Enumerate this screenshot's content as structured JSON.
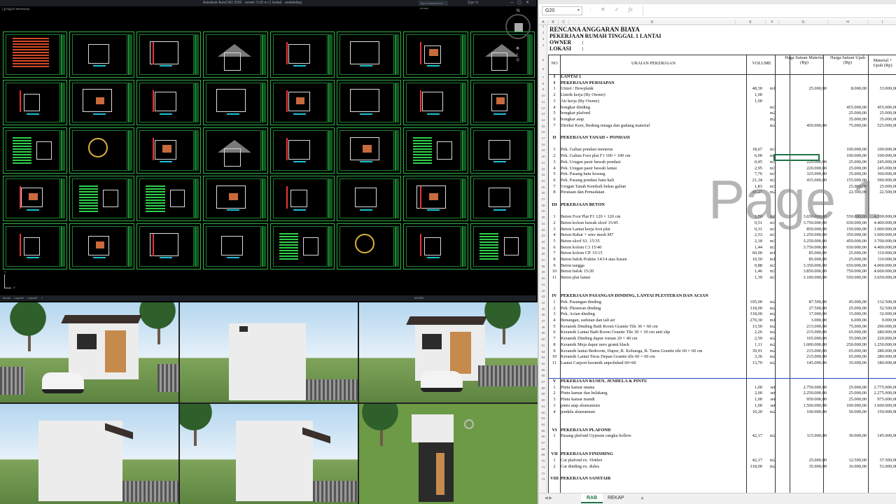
{
  "cad": {
    "title": "Autodesk AutoCAD 2020 · rumah 7x10 m (1 lantai) · arsitekdwg",
    "search_placeholder": "Type a keyword or phrase",
    "sign_in": "Sign In",
    "viewport_label": "[-][Top][2D Wireframe]",
    "compass_n": "N",
    "compass_top": "TOP",
    "tabs": [
      "Model",
      "Layout1",
      "Layout2",
      "+"
    ],
    "model_label": "MODEL"
  },
  "excel": {
    "namebox": "G20",
    "formula_symbol": "fx",
    "columns": [
      "A",
      "B",
      "C",
      "D",
      "E",
      "F",
      "G",
      "H",
      "I"
    ],
    "title": "RENCANA ANGGARAN BIAYA",
    "pekerjaan_label": "PEKERJAAN",
    "pekerjaan_value": ":  RUMAH TINGGAL 1 LANTAI",
    "owner_label": "OWNER",
    "owner_value": ":",
    "lokasi_label": "LOKASI",
    "lokasi_value": ":",
    "header": {
      "no": "NO",
      "uraian": "URAIAN PEKERJAAN",
      "volume": "VOLUME",
      "material": "Haga Satuan Material (Rp)",
      "upah": "Harga Satuan Upah (Rp)",
      "total": "Material + Upah (Rp)"
    },
    "watermark": "Page 1",
    "rows": [
      {
        "r": 7,
        "no": "I",
        "ur": "LANTAI 1",
        "sec": true
      },
      {
        "r": 8,
        "no": "I",
        "ur": "PEKERJAAN PERSIAPAN",
        "sec": true
      },
      {
        "r": 9,
        "no": "1",
        "ur": "Uitzet / Bowplank",
        "vol": "48,30",
        "sat": "m1",
        "mat": "25.000,00",
        "up": "8.000,00",
        "tot": "33.000,00"
      },
      {
        "r": 10,
        "no": "2",
        "ur": "Listrik kerja (By Owner)",
        "vol": "1,00",
        "tot": "-"
      },
      {
        "r": 11,
        "no": "3",
        "ur": "Air kerja (By Owner)",
        "vol": "1,00",
        "tot": "-"
      },
      {
        "r": 12,
        "no": "4",
        "ur": "bongkar dinding",
        "sat": "m3",
        "up": "455.000,00",
        "tot": "455.000,00"
      },
      {
        "r": 13,
        "no": "5",
        "ur": "bongkar plafond",
        "sat": "m2",
        "up": "25.000,00",
        "tot": "25.000,00"
      },
      {
        "r": 14,
        "no": "6",
        "ur": "bongkar atap",
        "sat": "m2",
        "up": "35.000,00",
        "tot": "35.000,00"
      },
      {
        "r": 15,
        "no": "7",
        "ur": "Direksi Keet, Bedeng tenaga dan gudang material",
        "sat": "m2",
        "mat": "450.000,00",
        "up": "75.000,00",
        "tot": "525.000,00"
      },
      {
        "r": 16
      },
      {
        "r": 17,
        "no": "II",
        "ur": "PEKERJAAN TANAH + PONDASI",
        "sec": true
      },
      {
        "r": 18
      },
      {
        "r": 19,
        "no": "1",
        "ur": "Pek. Galian pondasi menerus",
        "vol": "18,67",
        "sat": "m3",
        "up": "100.000,00",
        "tot": "100.000,00"
      },
      {
        "r": 20,
        "no": "2",
        "ur": "Pek. Galian Foot plat F1 100 × 100 cm",
        "vol": "6,00",
        "sat": "m3",
        "up": "100.000,00",
        "tot": "100.000,00"
      },
      {
        "r": 21,
        "no": "3",
        "ur": "Pek. Urugan pasir bawah pondasi",
        "vol": "0,45",
        "sat": "m3",
        "mat": "220.000,00",
        "up": "25.000,00",
        "tot": "245.000,00"
      },
      {
        "r": 22,
        "no": "4",
        "ur": "Pek. Urugan pasir bawah lantai",
        "vol": "2,95",
        "sat": "m3",
        "mat": "220.000,00",
        "up": "25.000,00",
        "tot": "245.000,00"
      },
      {
        "r": 23,
        "no": "5",
        "ur": "Pek. Pasang batu kosong",
        "vol": "7,76",
        "sat": "m3",
        "mat": "325.000,00",
        "up": "35.000,00",
        "tot": "360.000,00"
      },
      {
        "r": 24,
        "no": "6",
        "ur": "Pek. Pasang pondasi batu kali",
        "vol": "21,34",
        "sat": "m3",
        "mat": "435.000,00",
        "up": "155.000,00",
        "tot": "590.000,00"
      },
      {
        "r": 25,
        "no": "7",
        "ur": "Urugan Tanah Kembali bekas galian",
        "vol": "1,83",
        "sat": "m3",
        "up": "25.000,00",
        "tot": "25.000,00"
      },
      {
        "r": 26,
        "no": "8",
        "ur": "Perataan dan Pemadatan",
        "vol": "45,27",
        "sat": "m2",
        "up": "22.500,00",
        "tot": "22.500,00"
      },
      {
        "r": 27
      },
      {
        "r": 28,
        "no": "III",
        "ur": "PEKERJAAN BETON",
        "sec": true
      },
      {
        "r": 29
      },
      {
        "r": 30,
        "no": "1",
        "ur": "Beton Foot Plat F1 120 × 120 cm",
        "vol": "1,50",
        "sat": "m3",
        "mat": "3.650.000,00",
        "up": "550.000,00",
        "tot": "4.200.000,00"
      },
      {
        "r": 31,
        "no": "2",
        "ur": "Beton kolom bawah sloof 15/45",
        "vol": "0,51",
        "sat": "m3",
        "mat": "3.750.000,00",
        "up": "650.000,00",
        "tot": "4.400.000,00"
      },
      {
        "r": 32,
        "no": "3",
        "ur": "Beton Lantai kerja foot plat",
        "vol": "0,31",
        "sat": "m3",
        "mat": "850.000,00",
        "up": "150.000,00",
        "tot": "1.000.000,00"
      },
      {
        "r": 33,
        "no": "4",
        "ur": "Beton Rabat + wire mesh M7",
        "vol": "2,53",
        "sat": "m3",
        "mat": "1.250.000,00",
        "up": "350.000,00",
        "tot": "1.600.000,00"
      },
      {
        "r": 34,
        "no": "5",
        "ur": "Beton sloof S1. 15/35",
        "vol": "2,18",
        "sat": "m3",
        "mat": "3.250.000,00",
        "up": "450.000,00",
        "tot": "3.700.000,00"
      },
      {
        "r": 35,
        "no": "6",
        "ur": "Beton kolom C3 15/40",
        "vol": "1,44",
        "sat": "m3",
        "mat": "3.750.000,00",
        "up": "650.000,00",
        "tot": "4.400.000,00"
      },
      {
        "r": 36,
        "no": "7",
        "ur": "Beton kolom CP. 15/15",
        "vol": "60,00",
        "sat": "m1",
        "mat": "85.000,00",
        "up": "25.000,00",
        "tot": "110.000,00"
      },
      {
        "r": 37,
        "no": "8",
        "ur": "Beton balok Praktis 14/14 atas kusen",
        "vol": "10,50",
        "sat": "m1",
        "mat": "85.000,00",
        "up": "25.000,00",
        "tot": "110.000,00"
      },
      {
        "r": 38,
        "no": "9",
        "ur": "Beton tangga",
        "vol": "0,88",
        "sat": "m3",
        "mat": "3.350.000,00",
        "up": "650.000,00",
        "tot": "4.000.000,00"
      },
      {
        "r": 39,
        "no": "10",
        "ur": "Beton balok 15/20",
        "vol": "1,46",
        "sat": "m3",
        "mat": "3.850.000,00",
        "up": "750.000,00",
        "tot": "4.600.000,00"
      },
      {
        "r": 40,
        "no": "11",
        "ur": "Beton plat lantai",
        "vol": "1,39",
        "sat": "m3",
        "mat": "3.100.000,00",
        "up": "550.000,00",
        "tot": "3.650.000,00"
      },
      {
        "r": 41
      },
      {
        "r": 42
      },
      {
        "r": 43,
        "no": "IV",
        "ur": "PEKERJAAN PASANGAN DINDING, LANTAI PLESTERAN DAN ACIAN",
        "sec": true
      },
      {
        "r": 44,
        "no": "1",
        "ur": "Pek. Pasangan dinding",
        "vol": "195,00",
        "sat": "m2",
        "mat": "87.500,00",
        "up": "45.000,00",
        "tot": "132.500,00"
      },
      {
        "r": 45,
        "no": "2",
        "ur": "Pek. Plesteran dinding",
        "vol": "318,00",
        "sat": "m2",
        "mat": "27.500,00",
        "up": "25.000,00",
        "tot": "52.500,00"
      },
      {
        "r": 46,
        "no": "3",
        "ur": "Pek. Acian dinding",
        "vol": "318,00",
        "sat": "m2",
        "mat": "17.000,00",
        "up": "15.000,00",
        "tot": "32.000,00"
      },
      {
        "r": 47,
        "no": "4",
        "ur": "Benangan, sudutan dan tali air",
        "vol": "270,30",
        "sat": "m1",
        "mat": "3.000,00",
        "up": "6.000,00",
        "tot": "9.000,00"
      },
      {
        "r": 48,
        "no": "5",
        "ur": "Keramik Dinding Bath Room Granite Tile 30 × 60 cm",
        "vol": "13,50",
        "sat": "m2",
        "mat": "215.000,00",
        "up": "75.000,00",
        "tot": "290.000,00"
      },
      {
        "r": 49,
        "no": "6",
        "ur": "Keramik Lantai Bath Room Granite Tile 30 × 30 cm anti slip",
        "vol": "2,26",
        "sat": "m2",
        "mat": "215.000,00",
        "up": "65.000,00",
        "tot": "280.000,00"
      },
      {
        "r": 50,
        "no": "7",
        "ur": "Keramik Dinding dapur roman 20 × 40 cm",
        "vol": "2,59",
        "sat": "m2",
        "mat": "165.000,00",
        "up": "55.000,00",
        "tot": "220.000,00"
      },
      {
        "r": 51,
        "no": "8",
        "ur": "Keramik Meja dapur nero granit black",
        "vol": "1,11",
        "sat": "m2",
        "mat": "1.000.000,00",
        "up": "250.000,00",
        "tot": "1.250.000,00"
      },
      {
        "r": 52,
        "no": "9",
        "ur": "Keramik lantai Bedroom, Dapur, R. Keluarga, R. Tamu Granite tile 60 × 60 cm",
        "vol": "39,91",
        "sat": "m2",
        "mat": "215.000,00",
        "up": "65.000,00",
        "tot": "280.000,00"
      },
      {
        "r": 53,
        "no": "10",
        "ur": "Keramik Lantai Teras Depan Granite tile 60 × 60 cm",
        "vol": "3,36",
        "sat": "m2",
        "mat": "215.000,00",
        "up": "65.000,00",
        "tot": "280.000,00"
      },
      {
        "r": 54,
        "no": "11",
        "ur": "Lantai Carport keramik unpolished 60×60",
        "vol": "13,70",
        "sat": "m2",
        "mat": "145.000,00",
        "up": "35.000,00",
        "tot": "180.000,00"
      },
      {
        "r": 55
      },
      {
        "r": 56
      },
      {
        "r": 57,
        "no": "V",
        "ur": "PEKERJAAN KUSEN, JENDELA & PINTU",
        "sec": true
      },
      {
        "r": 58,
        "no": "1",
        "ur": "Pintu kamar utama",
        "vol": "1,00",
        "sat": "set",
        "mat": "2.750.000,00",
        "up": "25.000,00",
        "tot": "2.775.000,00"
      },
      {
        "r": 59,
        "no": "2",
        "ur": "Pintu kamar dan belakang",
        "vol": "2,00",
        "sat": "set",
        "mat": "2.250.000,00",
        "up": "25.000,00",
        "tot": "2.275.000,00"
      },
      {
        "r": 60,
        "no": "3",
        "ur": "Pintu kamar mandi",
        "vol": "1,00",
        "sat": "set",
        "mat": "950.000,00",
        "up": "25.000,00",
        "tot": "975.000,00"
      },
      {
        "r": 61,
        "no": "3",
        "ur": "pintu atap alumunium",
        "vol": "1,00",
        "sat": "set",
        "mat": "1.500.000,00",
        "up": "100.000,00",
        "tot": "1.600.000,00"
      },
      {
        "r": 62,
        "no": "4",
        "ur": "jendela alumunium",
        "vol": "10,20",
        "sat": "m2",
        "mat": "100.000,00",
        "up": "50.000,00",
        "tot": "150.000,00"
      },
      {
        "r": 63
      },
      {
        "r": 64
      },
      {
        "r": 65,
        "no": "VI",
        "ur": "PEKERJAAN PLAFOND",
        "sec": true
      },
      {
        "r": 66,
        "no": "1",
        "ur": "Pasang plafond Gypsum rangka hollow",
        "vol": "42,17",
        "sat": "m2",
        "mat": "115.000,00",
        "up": "30.000,00",
        "tot": "145.000,00"
      },
      {
        "r": 67
      },
      {
        "r": 68
      },
      {
        "r": 69,
        "no": "VII",
        "ur": "PEKERJAAN FINISHING",
        "sec": true
      },
      {
        "r": 70,
        "no": "1",
        "ur": "Cat plafond ex. Vinilex",
        "vol": "42,17",
        "sat": "m2",
        "mat": "25.000,00",
        "up": "12.500,00",
        "tot": "37.500,00"
      },
      {
        "r": 71,
        "no": "2",
        "ur": "Cat dinding ex. dulux",
        "vol": "318,00",
        "sat": "m2",
        "mat": "35.000,00",
        "up": "16.000,00",
        "tot": "51.000,00"
      },
      {
        "r": 72
      },
      {
        "r": 73,
        "no": "VIII",
        "ur": "PEKERJAAN SANITAIR",
        "sec": true
      }
    ],
    "tabs": {
      "active": "RAB",
      "other": "REKAP",
      "add": "+",
      "nav": "◀ ▶"
    }
  },
  "colors": {
    "cad_frame": "#2fb34a",
    "excel_accent": "#217346"
  }
}
